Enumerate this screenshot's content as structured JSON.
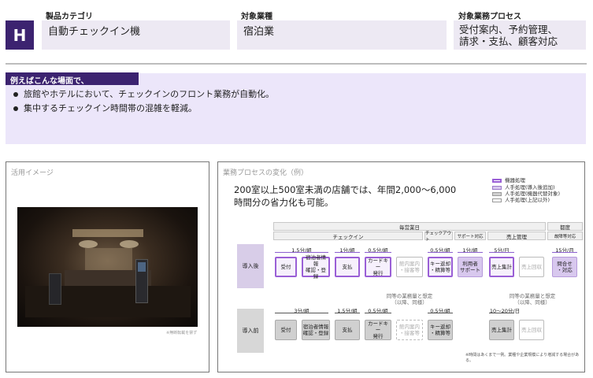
{
  "header": {
    "letter": "H",
    "category_label": "製品カテゴリ",
    "category_value": "自動チェックイン機",
    "industry_label": "対象業種",
    "industry_value": "宿泊業",
    "process_label": "対象業務プロセス",
    "process_value_line1": "受付案内、予約管理、",
    "process_value_line2": "請求・支払、顧客対応"
  },
  "example": {
    "tag": "例えばこんな場面で、",
    "bullets": [
      "旅館やホテルにおいて、チェックインのフロント業務が自動化。",
      "集中するチェックイン時間帯の混雑を軽減。"
    ]
  },
  "image_panel": {
    "title": "活用イメージ",
    "note": "※無断転載を禁ず"
  },
  "process_panel": {
    "title": "業務プロセスの変化（例）",
    "headline_line1": "200室以上500室未満の店舗では、年間2,000～6,000",
    "headline_line2": "時間分の省力化も可能。",
    "legend": {
      "machine": "機器処理",
      "manual_added": "人手処理(導入後追加)",
      "manual_replaced": "人手処理(機器代替対象)",
      "manual_other": "人手処理(上記以外)"
    },
    "bands": {
      "daily": "毎営業日",
      "anytime": "都度",
      "checkin": "チェックイン",
      "checkout": "チェックアウト",
      "support": "サポート対応",
      "sales": "売上管理",
      "failure": "故障等対応"
    },
    "after": {
      "label": "導入後",
      "steps": [
        "受付",
        "宿泊者情報\n確認・登録",
        "支払",
        "カードキー\n発行",
        "館内案内\n・接客等",
        "キー返却\n・精算等",
        "利用者\nサポート",
        "売上集計",
        "売上回収",
        "問合せ\n・対応"
      ],
      "times": [
        "1.5分/組",
        "1分/組",
        "0.5分/組",
        "0.5分/組",
        "1分/組",
        "5分/日",
        "15分/月"
      ]
    },
    "same_note": "同等の業務量と想定\n（以降、同様）",
    "before": {
      "label": "導入前",
      "steps": [
        "受付",
        "宿泊者情報\n確認・登録",
        "支払",
        "カードキー\n発行",
        "館内案内\n・接客等",
        "キー返却\n・精算等",
        "売上集計",
        "売上回収"
      ],
      "times": [
        "3分/組",
        "1.5分/組",
        "0.5分/組",
        "0.5分/組",
        "10～20分/日"
      ]
    },
    "footnote": "※時間はあくまで一例。業種や企業規模により増減する場合がある。"
  },
  "colors": {
    "brand_dark": "#3c2370",
    "lilac_bg": "#ece6fa",
    "machine_border": "#9a5fd6"
  }
}
